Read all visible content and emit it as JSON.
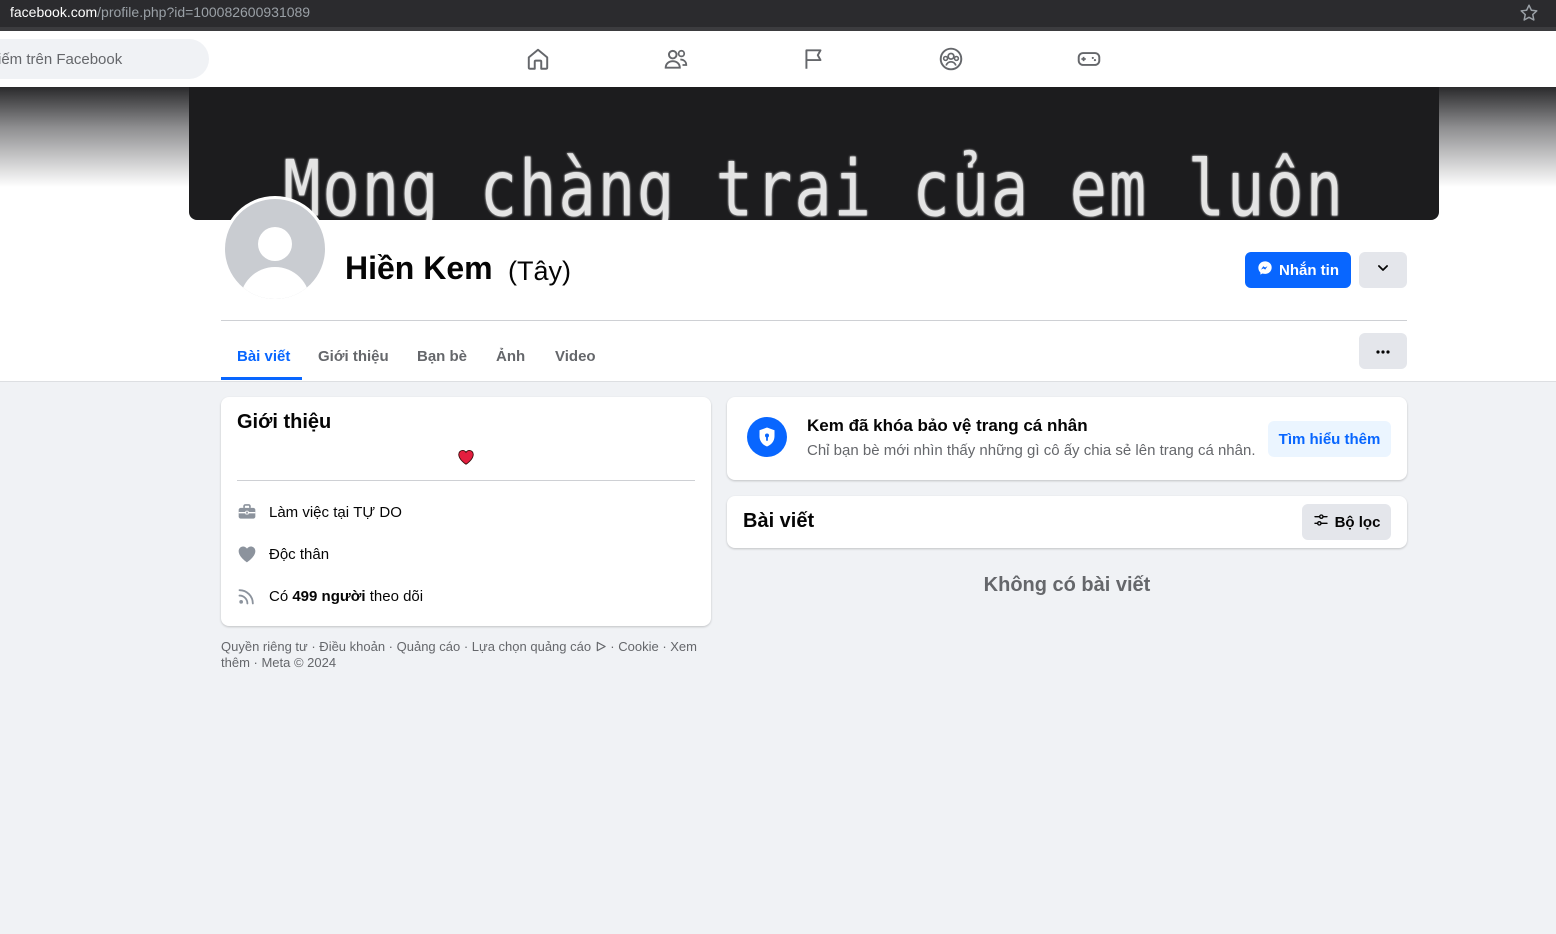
{
  "browser": {
    "url_domain": "facebook.com",
    "url_path": "/profile.php?id=100082600931089",
    "bookmark_icon": "star-icon"
  },
  "topnav": {
    "search_placeholder": "iếm trên Facebook",
    "icons": [
      "home-icon",
      "friends-icon",
      "pages-flag-icon",
      "groups-icon",
      "gaming-icon"
    ]
  },
  "profile": {
    "cover_text": "Mong chàng trai của em luôn cười!",
    "name": "Hiền Kem",
    "alternate_name": "(Tây)",
    "message_button": "Nhắn tin"
  },
  "tabs": [
    {
      "label": "Bài viết",
      "active": true
    },
    {
      "label": "Giới thiệu",
      "active": false
    },
    {
      "label": "Bạn bè",
      "active": false
    },
    {
      "label": "Ảnh",
      "active": false
    },
    {
      "label": "Video",
      "active": false
    }
  ],
  "intro": {
    "title": "Giới thiệu",
    "work_prefix": "Làm việc tại ",
    "work_place": "TỰ DO",
    "relationship": "Độc thân",
    "followers_prefix": "Có ",
    "followers_count": "499 người",
    "followers_suffix": " theo dõi"
  },
  "footer": {
    "text_before_icon": "Quyền riêng tư · Điều khoản · Quảng cáo · Lựa chọn quảng cáo ",
    "text_after_icon": " · Cookie · Xem thêm · Meta © 2024"
  },
  "lock_notice": {
    "title": "Kem đã khóa bảo vệ trang cá nhân",
    "subtitle": "Chỉ bạn bè mới nhìn thấy những gì cô ấy chia sẻ lên trang cá nhân.",
    "learn_more": "Tìm hiểu thêm"
  },
  "posts": {
    "title": "Bài viết",
    "filter_label": "Bộ lọc",
    "empty_text": "Không có bài viết"
  },
  "colors": {
    "accent": "#0866ff",
    "background": "#f0f2f5",
    "secondary_text": "#65676b",
    "heart": "#e41e3f"
  }
}
